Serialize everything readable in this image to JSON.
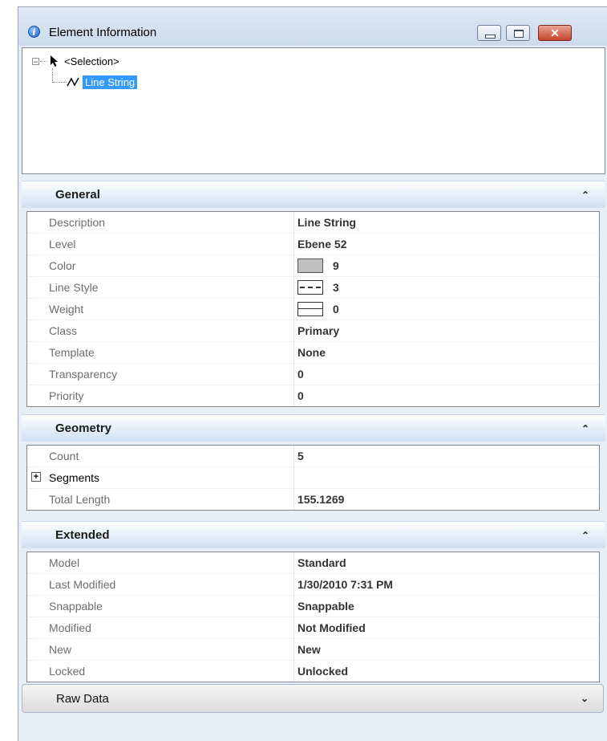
{
  "window": {
    "title": "Element Information",
    "info_icon": "i",
    "close_glyph": "✕"
  },
  "tree": {
    "root_expander": "−",
    "root_label": "<Selection>",
    "child_label": "Line String",
    "root_icon": "arrow-cursor-icon",
    "child_icon": "line-string-icon"
  },
  "sections": {
    "general": {
      "title": "General",
      "chevron": "⌃",
      "rows": [
        {
          "name": "Description",
          "value": "Line String"
        },
        {
          "name": "Level",
          "value": "Ebene 52"
        },
        {
          "name": "Color",
          "value": "9",
          "swatch": "color",
          "swatch_color": "#c0c0c0"
        },
        {
          "name": "Line Style",
          "value": "3",
          "swatch": "style"
        },
        {
          "name": "Weight",
          "value": "0",
          "swatch": "weight"
        },
        {
          "name": "Class",
          "value": "Primary"
        },
        {
          "name": "Template",
          "value": "None"
        },
        {
          "name": "Transparency",
          "value": "0"
        },
        {
          "name": "Priority",
          "value": "0"
        }
      ]
    },
    "geometry": {
      "title": "Geometry",
      "chevron": "⌃",
      "rows": [
        {
          "name": "Count",
          "value": "5"
        },
        {
          "name": "Segments",
          "value": "",
          "expandable": true,
          "expander": "+"
        },
        {
          "name": "Total Length",
          "value": "155.1269"
        }
      ]
    },
    "extended": {
      "title": "Extended",
      "chevron": "⌃",
      "rows": [
        {
          "name": "Model",
          "value": "Standard"
        },
        {
          "name": "Last Modified",
          "value": "1/30/2010 7:31 PM"
        },
        {
          "name": "Snappable",
          "value": "Snappable"
        },
        {
          "name": "Modified",
          "value": "Not Modified"
        },
        {
          "name": "New",
          "value": "New"
        },
        {
          "name": "Locked",
          "value": "Unlocked"
        }
      ]
    },
    "raw_data": {
      "title": "Raw Data",
      "chevron": "⌄"
    }
  },
  "colors": {
    "selection_highlight": "#3399ff",
    "section_header_gradient_end": "#cfe0f3",
    "color_swatch": "#c0c0c0"
  }
}
